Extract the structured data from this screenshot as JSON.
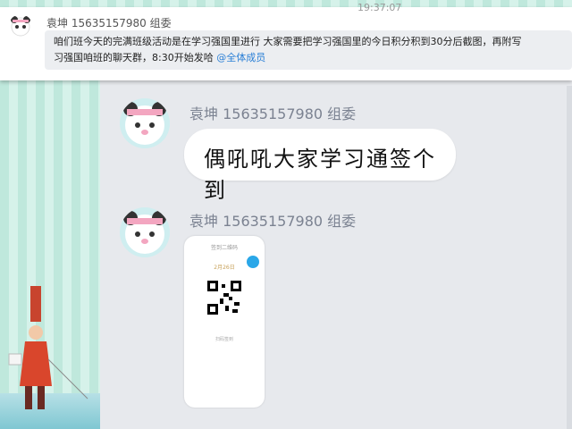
{
  "banner": {
    "time": "19:37:07",
    "sender": "袁坤 15635157980 组委",
    "message_text": "咱们班今天的完满班级活动是在学习强国里进行 大家需要把学习强国里的今日积分积到30分后截图，再附写",
    "message_text_2": "习强国咱班的聊天群，8:30开始发哈",
    "mention": "@全体成员"
  },
  "chat": {
    "messages": [
      {
        "sender": "袁坤 15635157980 组委",
        "text": "偶吼吼大家学习通签个到"
      },
      {
        "sender": "袁坤 15635157980 组委",
        "phone_title": "签到二维码",
        "phone_label": "2月26日",
        "phone_hint": "扫码签到"
      }
    ]
  },
  "colors": {
    "accent": "#2a7fd6",
    "wallpaper": "#bfe8dc",
    "chat_bg": "#e7e9ed",
    "bubble": "#ffffff"
  },
  "icons": [
    "panda-avatar-icon",
    "qr-code-icon",
    "figure-illustration"
  ]
}
